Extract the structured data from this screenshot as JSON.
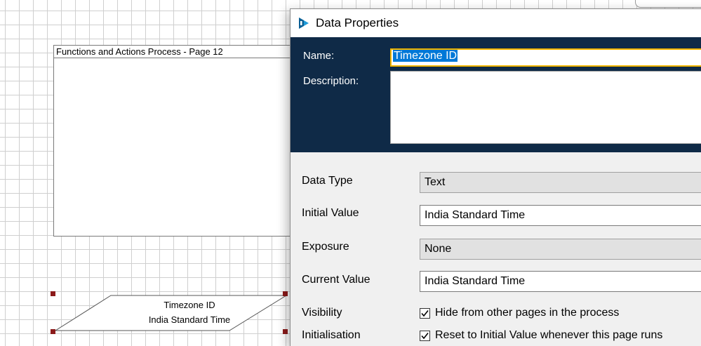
{
  "canvas": {
    "page_box_title": "Functions and Actions Process - Page 12",
    "data_item": {
      "name": "Timezone ID",
      "value": "India Standard Time"
    }
  },
  "dialog": {
    "title": "Data Properties",
    "icon": "blue-prism-icon",
    "header_bg": "#0f2a47",
    "name_label": "Name:",
    "name_value": "Timezone ID",
    "description_label": "Description:",
    "description_value": "",
    "fields": {
      "data_type": {
        "label": "Data Type",
        "value": "Text"
      },
      "initial_value": {
        "label": "Initial Value",
        "value": "India Standard Time"
      },
      "exposure": {
        "label": "Exposure",
        "value": "None"
      },
      "current_value": {
        "label": "Current Value",
        "value": "India Standard Time"
      }
    },
    "visibility": {
      "label": "Visibility",
      "checkbox_label": "Hide from other pages in the process",
      "checked": true
    },
    "initialisation": {
      "label": "Initialisation",
      "checkbox_label": "Reset to Initial Value whenever this page runs",
      "checked": true
    }
  }
}
